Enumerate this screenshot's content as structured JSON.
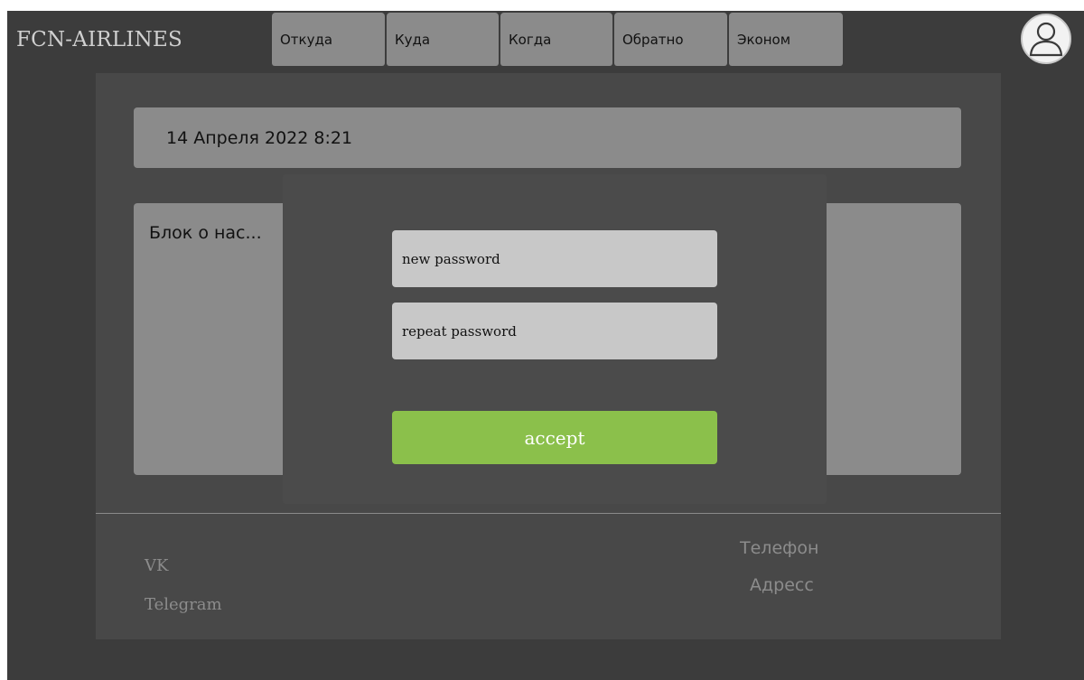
{
  "header": {
    "logo": "FCN-AIRLINES",
    "tabs": [
      {
        "label": "Откуда"
      },
      {
        "label": "Куда"
      },
      {
        "label": "Когда"
      },
      {
        "label": "Обратно"
      },
      {
        "label": "Эконом"
      }
    ],
    "avatar_icon": "user-avatar-icon"
  },
  "main": {
    "date": "14 Апреля 2022 8:21",
    "about": "Блок о нас..."
  },
  "footer": {
    "links": [
      "VK",
      "Telegram"
    ],
    "info": [
      "Телефон",
      "Адресс"
    ]
  },
  "modal": {
    "new_password_placeholder": "new password",
    "repeat_password_placeholder": "repeat password",
    "accept_label": "accept",
    "accept_color": "#8bc04b"
  }
}
